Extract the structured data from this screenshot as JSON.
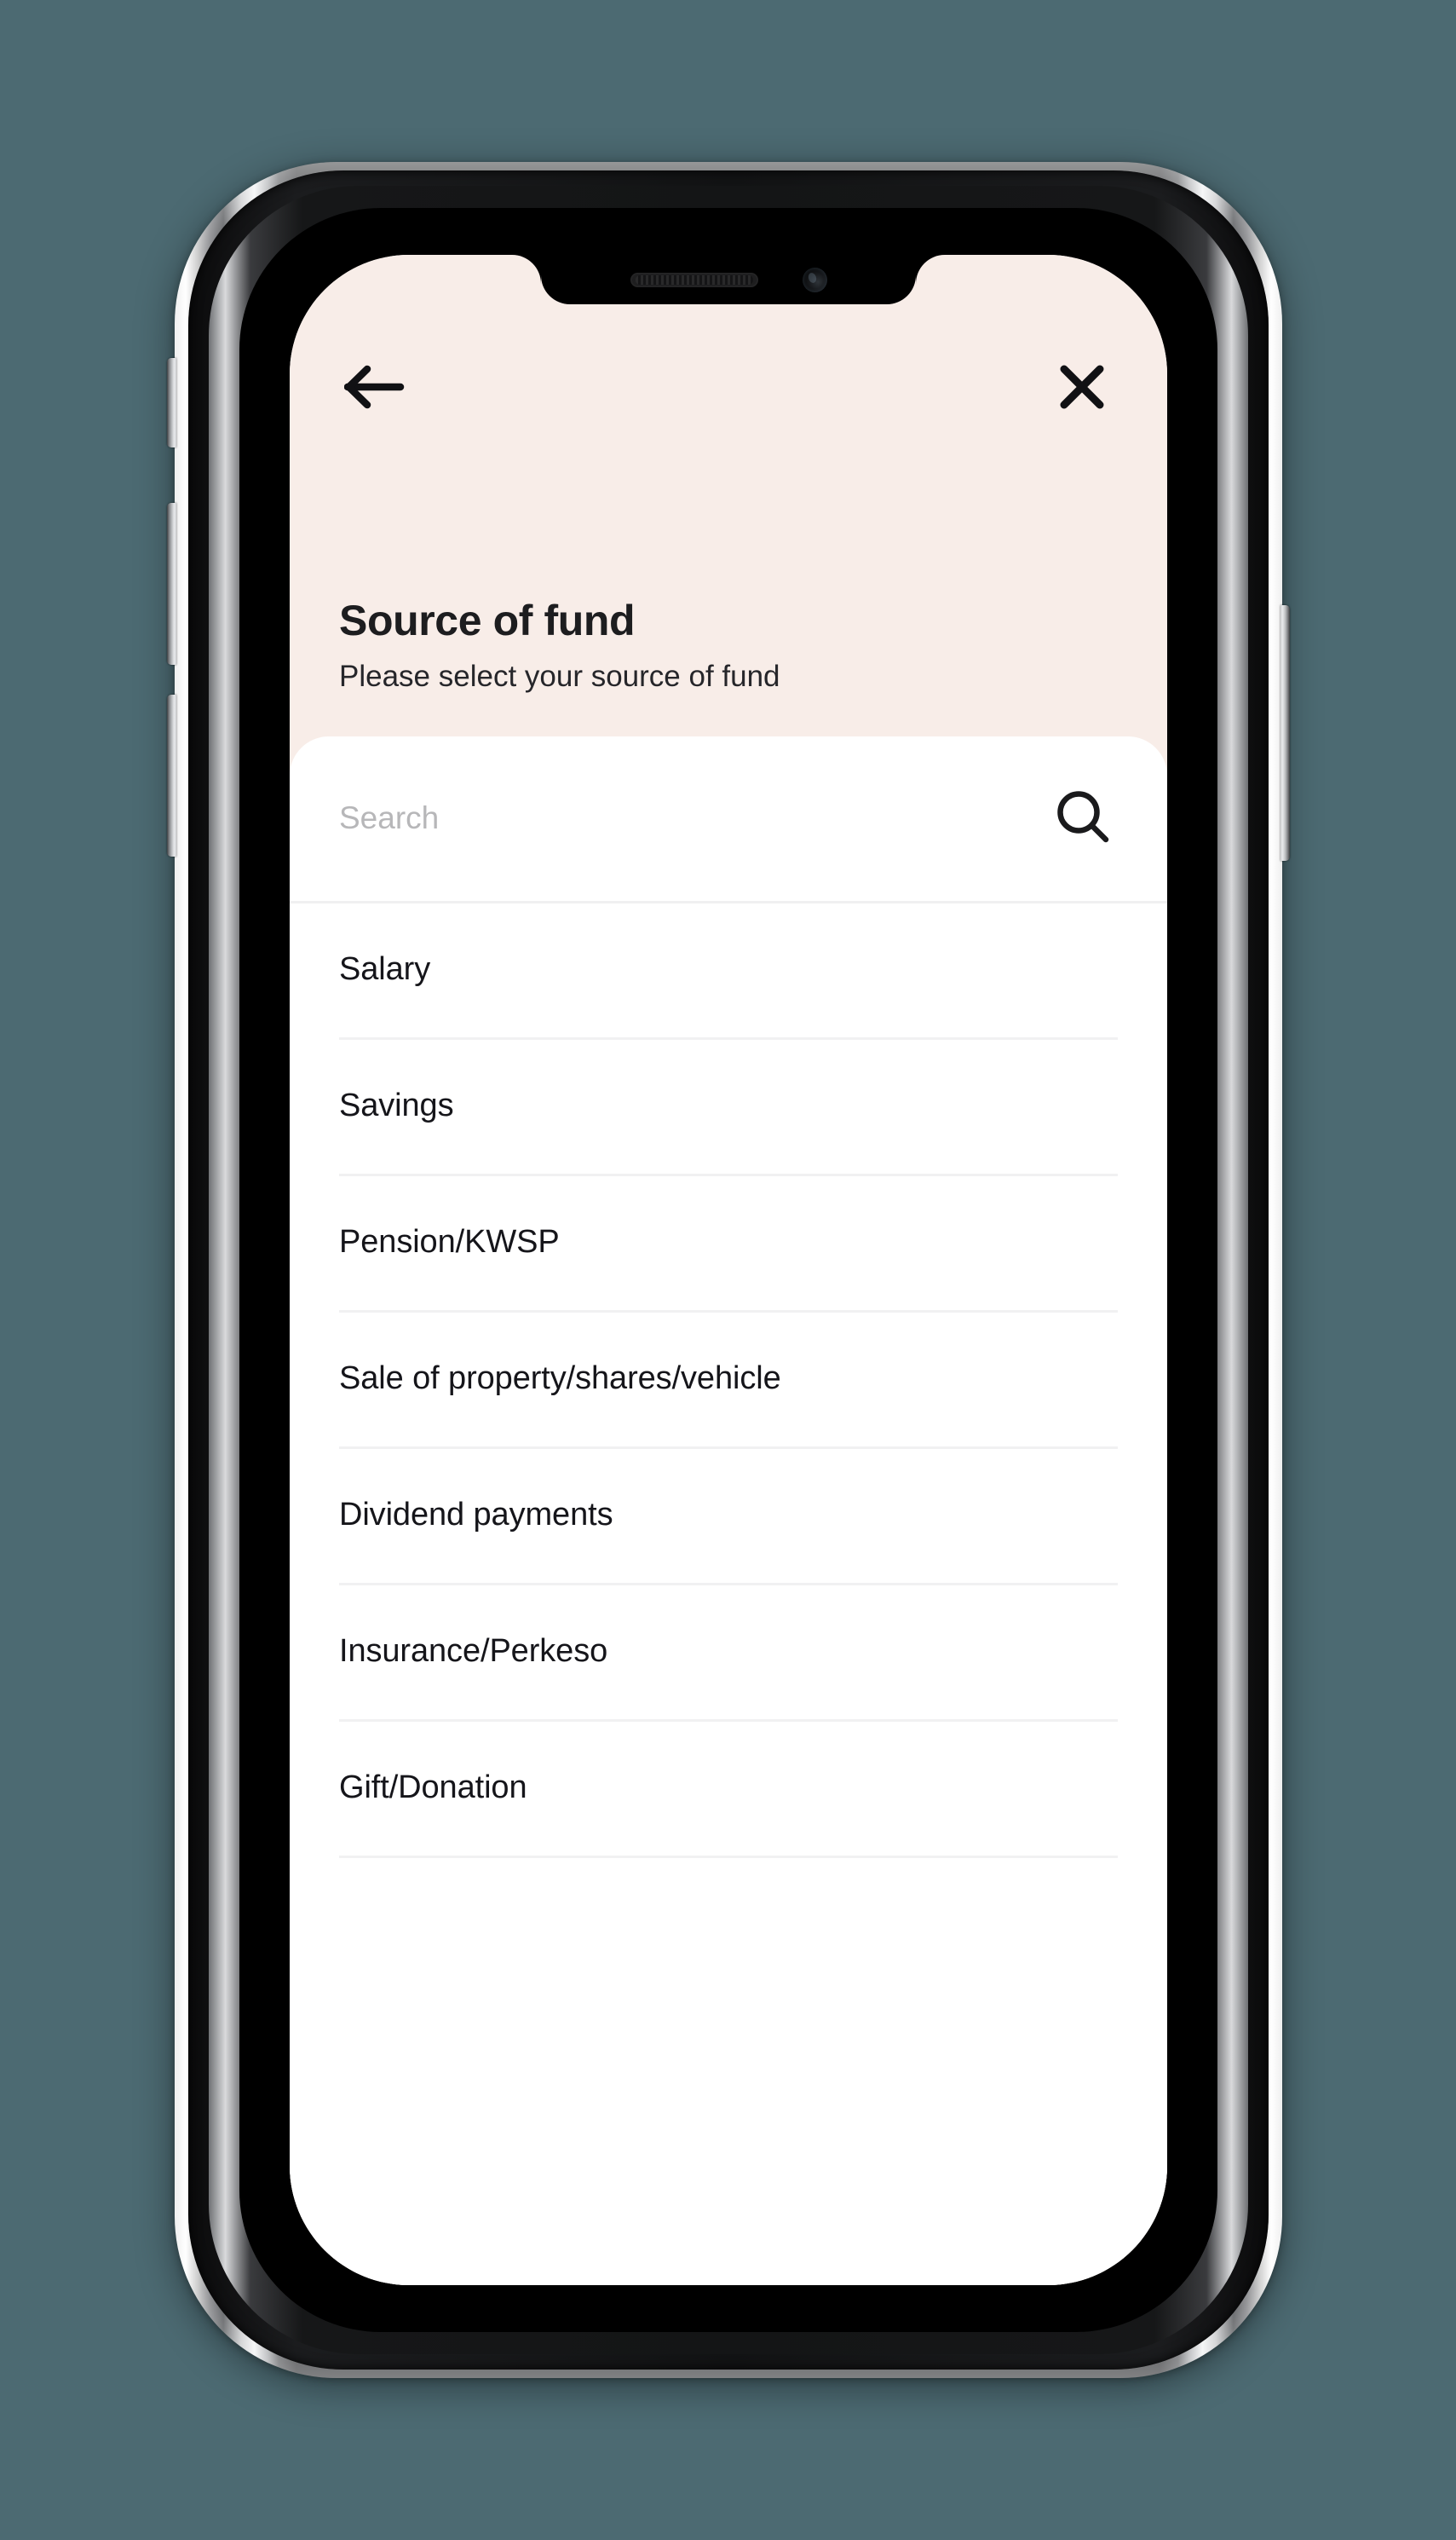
{
  "background_color": "#4c6a72",
  "device": {
    "name": "smartphone-mockup",
    "buttons": {
      "mute": "mute-switch",
      "volume_up": "volume-up-button",
      "volume_down": "volume-down-button",
      "power": "power-button"
    },
    "notch": {
      "speaker": "speaker-grille",
      "camera": "front-camera"
    }
  },
  "theme": {
    "header_background": "#f8ede8",
    "sheet_background": "#ffffff",
    "title_color": "#1d1d1f",
    "divider_color": "#f1f1f2",
    "placeholder_color": "#b7b7b9"
  },
  "nav": {
    "back_icon": "arrow-left-icon",
    "close_icon": "close-icon"
  },
  "header": {
    "title": "Source of fund",
    "subtitle": "Please select your source of fund"
  },
  "search": {
    "placeholder": "Search",
    "value": "",
    "icon": "search-icon"
  },
  "options": [
    {
      "label": "Salary"
    },
    {
      "label": "Savings"
    },
    {
      "label": "Pension/KWSP"
    },
    {
      "label": "Sale of property/shares/vehicle"
    },
    {
      "label": "Dividend payments"
    },
    {
      "label": "Insurance/Perkeso"
    },
    {
      "label": "Gift/Donation"
    }
  ]
}
